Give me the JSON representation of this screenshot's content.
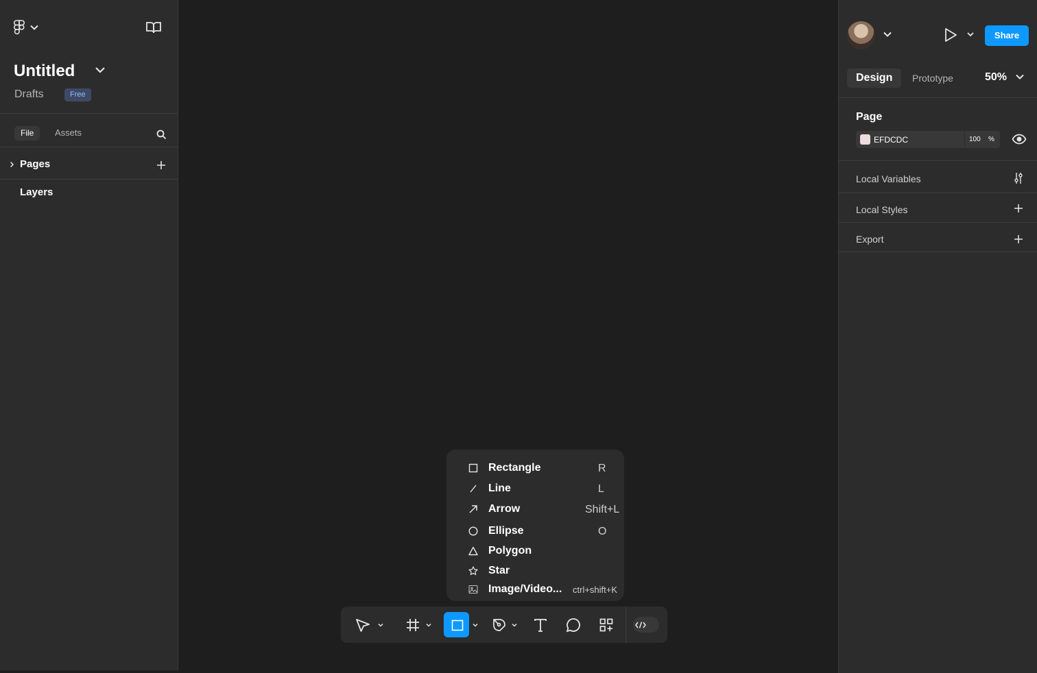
{
  "left_panel": {
    "file_title": "Untitled",
    "location": "Drafts",
    "plan_badge": "Free",
    "tabs": [
      {
        "label": "File"
      },
      {
        "label": "Assets"
      }
    ],
    "pages_label": "Pages",
    "layers_label": "Layers"
  },
  "right_panel": {
    "share_label": "Share",
    "tabs": [
      {
        "label": "Design"
      },
      {
        "label": "Prototype"
      }
    ],
    "zoom": "50%",
    "page_section": {
      "label": "Page",
      "color_hex": "EFDCDC",
      "opacity": "100",
      "opacity_unit": "%"
    },
    "sections": [
      {
        "label": "Local Variables",
        "icon": "sliders-icon"
      },
      {
        "label": "Local Styles",
        "icon": "plus-icon"
      },
      {
        "label": "Export",
        "icon": "plus-icon"
      }
    ]
  },
  "shape_menu": {
    "items": [
      {
        "label": "Rectangle",
        "shortcut": "R",
        "icon": "rectangle-icon"
      },
      {
        "label": "Line",
        "shortcut": "L",
        "icon": "line-icon"
      },
      {
        "label": "Arrow",
        "shortcut": "Shift+L",
        "icon": "arrow-icon"
      },
      {
        "label": "Ellipse",
        "shortcut": "O",
        "icon": "ellipse-icon"
      },
      {
        "label": "Polygon",
        "shortcut": "",
        "icon": "polygon-icon"
      },
      {
        "label": "Star",
        "shortcut": "",
        "icon": "star-icon"
      },
      {
        "label": "Image/Video...",
        "shortcut": "ctrl+shift+K",
        "icon": "image-icon"
      }
    ]
  },
  "toolbar": {
    "tools": [
      "move-tool",
      "frame-tool",
      "shape-tool",
      "pen-tool",
      "text-tool",
      "comment-tool",
      "actions-tool",
      "dev-mode-toggle"
    ],
    "active_tool": "shape-tool"
  },
  "colors": {
    "accent": "#0d99ff",
    "panel": "#2c2c2c",
    "canvas": "#1e1e1e",
    "page_color": "#efdcdc"
  }
}
